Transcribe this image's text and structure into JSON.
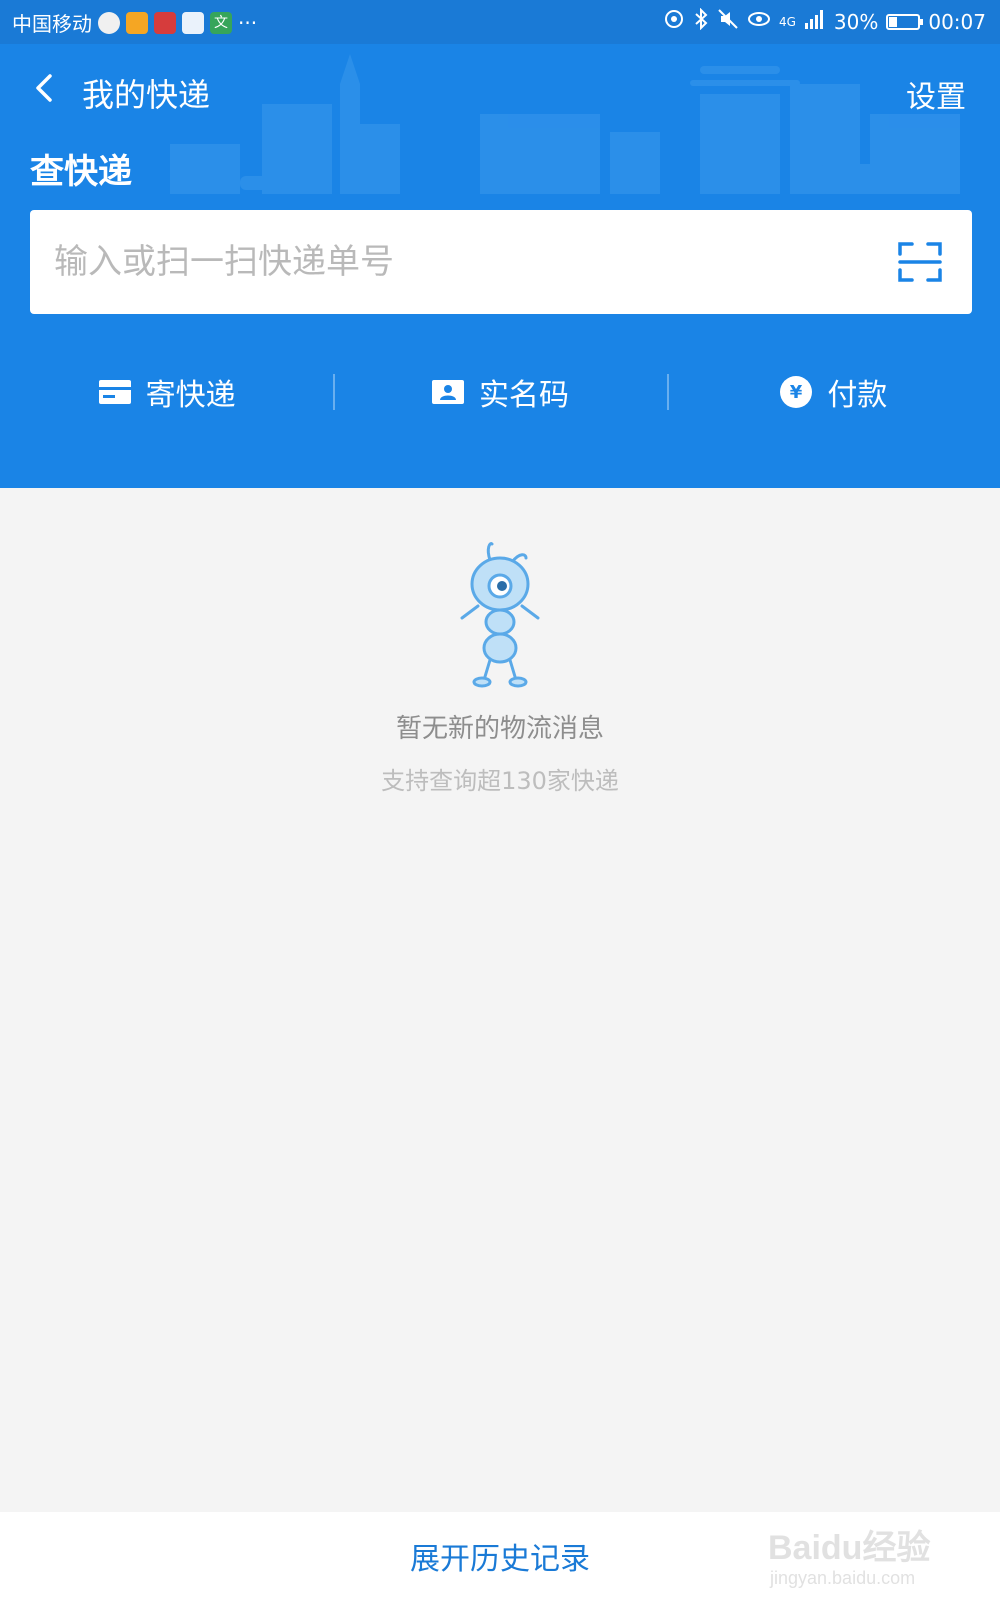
{
  "status_bar": {
    "carrier": "中国移动",
    "app_icons": [
      "weibo-icon",
      "weibo-icon",
      "red-app-icon",
      "video-app-icon",
      "wen-app-icon"
    ],
    "app_wen_label": "文",
    "more": "···",
    "network": "4G",
    "battery_percent": "30%",
    "battery_level": 0.3,
    "time": "00:07"
  },
  "nav": {
    "title": "我的快递",
    "settings_label": "设置"
  },
  "query": {
    "section_title": "查快递",
    "placeholder": "输入或扫一扫快递单号",
    "value": ""
  },
  "actions": [
    {
      "label": "寄快递",
      "icon": "card-icon"
    },
    {
      "label": "实名码",
      "icon": "id-badge-icon"
    },
    {
      "label": "付款",
      "icon": "yuan-coin-icon"
    }
  ],
  "payment_symbol": "¥",
  "empty_state": {
    "title": "暂无新的物流消息",
    "subtitle": "支持查询超130家快递"
  },
  "footer": {
    "expand_label": "展开历史记录"
  },
  "watermark": {
    "logo": "Baidu经验",
    "url": "jingyan.baidu.com"
  },
  "colors": {
    "header_blue": "#1a84e6",
    "statusbar_blue": "#1a7ad6",
    "link_blue": "#1a7ad6",
    "background": "#f4f4f4"
  }
}
